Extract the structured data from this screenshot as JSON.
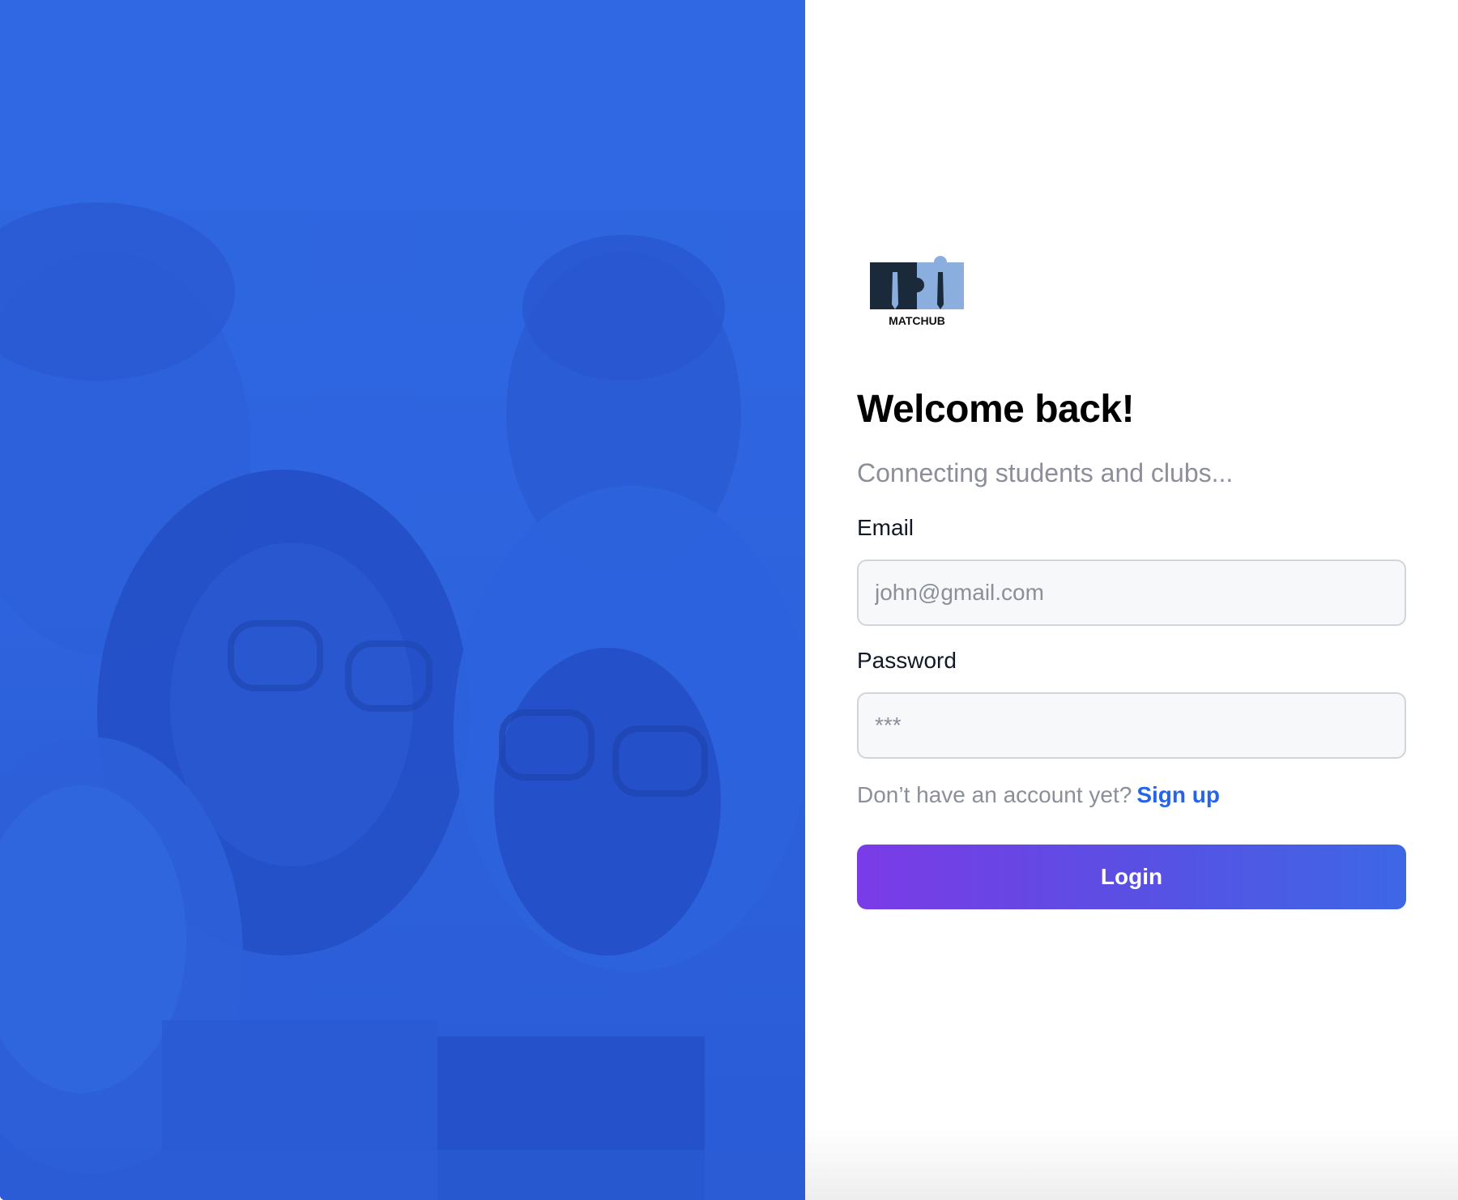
{
  "brand": {
    "logo_text": "MATCHUB",
    "accent": "#2563eb",
    "hero_overlay": "#2f66e0"
  },
  "hero": {
    "image_description_icon": "students-group-photo"
  },
  "login": {
    "title": "Welcome back!",
    "subtitle": "Connecting students and clubs...",
    "email_label": "Email",
    "email_placeholder": "john@gmail.com",
    "email_value": "",
    "password_label": "Password",
    "password_placeholder": "***",
    "password_value": "",
    "signup_prompt": "Don’t have an account yet?",
    "signup_link": "Sign up",
    "login_button": "Login",
    "button_gradient": [
      "#7b3be6",
      "#3d67e6"
    ]
  }
}
